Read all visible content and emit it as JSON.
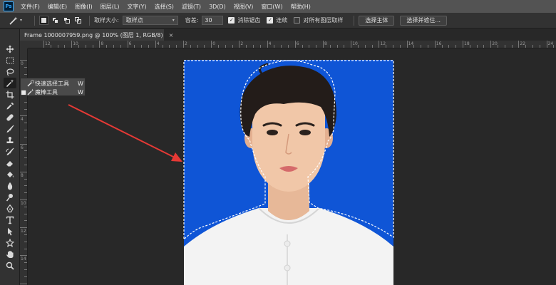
{
  "app": {
    "logo": "Ps"
  },
  "menu": [
    "文件(F)",
    "编辑(E)",
    "图像(I)",
    "图层(L)",
    "文字(Y)",
    "选择(S)",
    "滤镜(T)",
    "3D(D)",
    "视图(V)",
    "窗口(W)",
    "帮助(H)"
  ],
  "options": {
    "sample_size_label": "取样大小:",
    "sample_size_value": "取样点",
    "tolerance_label": "容差:",
    "tolerance_value": "30",
    "antialias_label": "消除锯齿",
    "contiguous_label": "连续",
    "all_layers_label": "对所有图层取样",
    "select_subject_label": "选择主体",
    "select_mask_label": "选择并遮住..."
  },
  "document": {
    "tab_title": "Frame 1000007959.png @ 100% (图层 1, RGB/8)",
    "close_label": "×"
  },
  "ruler_h_labels": [
    "12",
    "10",
    "8",
    "6",
    "4",
    "2",
    "0",
    "2",
    "4",
    "6",
    "8",
    "10",
    "12",
    "14",
    "16",
    "18",
    "20",
    "22",
    "24"
  ],
  "ruler_v_labels": [
    "0",
    "2",
    "4",
    "6",
    "8",
    "10",
    "12",
    "14",
    "16"
  ],
  "flyout": {
    "items": [
      {
        "label": "快速选择工具",
        "shortcut": "W",
        "active": false
      },
      {
        "label": "魔棒工具",
        "shortcut": "W",
        "active": true
      }
    ],
    "bullet": "■"
  },
  "colors": {
    "photo_background": "#0f55d6",
    "arrow": "#e53935",
    "selection": "#ffffff"
  }
}
